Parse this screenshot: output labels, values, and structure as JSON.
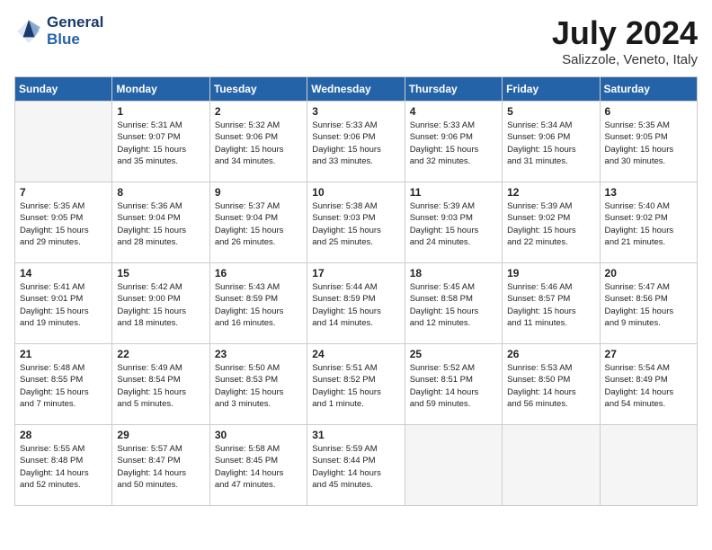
{
  "header": {
    "logo_line1": "General",
    "logo_line2": "Blue",
    "month": "July 2024",
    "location": "Salizzole, Veneto, Italy"
  },
  "weekdays": [
    "Sunday",
    "Monday",
    "Tuesday",
    "Wednesday",
    "Thursday",
    "Friday",
    "Saturday"
  ],
  "weeks": [
    [
      {
        "day": "",
        "info": ""
      },
      {
        "day": "1",
        "info": "Sunrise: 5:31 AM\nSunset: 9:07 PM\nDaylight: 15 hours\nand 35 minutes."
      },
      {
        "day": "2",
        "info": "Sunrise: 5:32 AM\nSunset: 9:06 PM\nDaylight: 15 hours\nand 34 minutes."
      },
      {
        "day": "3",
        "info": "Sunrise: 5:33 AM\nSunset: 9:06 PM\nDaylight: 15 hours\nand 33 minutes."
      },
      {
        "day": "4",
        "info": "Sunrise: 5:33 AM\nSunset: 9:06 PM\nDaylight: 15 hours\nand 32 minutes."
      },
      {
        "day": "5",
        "info": "Sunrise: 5:34 AM\nSunset: 9:06 PM\nDaylight: 15 hours\nand 31 minutes."
      },
      {
        "day": "6",
        "info": "Sunrise: 5:35 AM\nSunset: 9:05 PM\nDaylight: 15 hours\nand 30 minutes."
      }
    ],
    [
      {
        "day": "7",
        "info": "Sunrise: 5:35 AM\nSunset: 9:05 PM\nDaylight: 15 hours\nand 29 minutes."
      },
      {
        "day": "8",
        "info": "Sunrise: 5:36 AM\nSunset: 9:04 PM\nDaylight: 15 hours\nand 28 minutes."
      },
      {
        "day": "9",
        "info": "Sunrise: 5:37 AM\nSunset: 9:04 PM\nDaylight: 15 hours\nand 26 minutes."
      },
      {
        "day": "10",
        "info": "Sunrise: 5:38 AM\nSunset: 9:03 PM\nDaylight: 15 hours\nand 25 minutes."
      },
      {
        "day": "11",
        "info": "Sunrise: 5:39 AM\nSunset: 9:03 PM\nDaylight: 15 hours\nand 24 minutes."
      },
      {
        "day": "12",
        "info": "Sunrise: 5:39 AM\nSunset: 9:02 PM\nDaylight: 15 hours\nand 22 minutes."
      },
      {
        "day": "13",
        "info": "Sunrise: 5:40 AM\nSunset: 9:02 PM\nDaylight: 15 hours\nand 21 minutes."
      }
    ],
    [
      {
        "day": "14",
        "info": "Sunrise: 5:41 AM\nSunset: 9:01 PM\nDaylight: 15 hours\nand 19 minutes."
      },
      {
        "day": "15",
        "info": "Sunrise: 5:42 AM\nSunset: 9:00 PM\nDaylight: 15 hours\nand 18 minutes."
      },
      {
        "day": "16",
        "info": "Sunrise: 5:43 AM\nSunset: 8:59 PM\nDaylight: 15 hours\nand 16 minutes."
      },
      {
        "day": "17",
        "info": "Sunrise: 5:44 AM\nSunset: 8:59 PM\nDaylight: 15 hours\nand 14 minutes."
      },
      {
        "day": "18",
        "info": "Sunrise: 5:45 AM\nSunset: 8:58 PM\nDaylight: 15 hours\nand 12 minutes."
      },
      {
        "day": "19",
        "info": "Sunrise: 5:46 AM\nSunset: 8:57 PM\nDaylight: 15 hours\nand 11 minutes."
      },
      {
        "day": "20",
        "info": "Sunrise: 5:47 AM\nSunset: 8:56 PM\nDaylight: 15 hours\nand 9 minutes."
      }
    ],
    [
      {
        "day": "21",
        "info": "Sunrise: 5:48 AM\nSunset: 8:55 PM\nDaylight: 15 hours\nand 7 minutes."
      },
      {
        "day": "22",
        "info": "Sunrise: 5:49 AM\nSunset: 8:54 PM\nDaylight: 15 hours\nand 5 minutes."
      },
      {
        "day": "23",
        "info": "Sunrise: 5:50 AM\nSunset: 8:53 PM\nDaylight: 15 hours\nand 3 minutes."
      },
      {
        "day": "24",
        "info": "Sunrise: 5:51 AM\nSunset: 8:52 PM\nDaylight: 15 hours\nand 1 minute."
      },
      {
        "day": "25",
        "info": "Sunrise: 5:52 AM\nSunset: 8:51 PM\nDaylight: 14 hours\nand 59 minutes."
      },
      {
        "day": "26",
        "info": "Sunrise: 5:53 AM\nSunset: 8:50 PM\nDaylight: 14 hours\nand 56 minutes."
      },
      {
        "day": "27",
        "info": "Sunrise: 5:54 AM\nSunset: 8:49 PM\nDaylight: 14 hours\nand 54 minutes."
      }
    ],
    [
      {
        "day": "28",
        "info": "Sunrise: 5:55 AM\nSunset: 8:48 PM\nDaylight: 14 hours\nand 52 minutes."
      },
      {
        "day": "29",
        "info": "Sunrise: 5:57 AM\nSunset: 8:47 PM\nDaylight: 14 hours\nand 50 minutes."
      },
      {
        "day": "30",
        "info": "Sunrise: 5:58 AM\nSunset: 8:45 PM\nDaylight: 14 hours\nand 47 minutes."
      },
      {
        "day": "31",
        "info": "Sunrise: 5:59 AM\nSunset: 8:44 PM\nDaylight: 14 hours\nand 45 minutes."
      },
      {
        "day": "",
        "info": ""
      },
      {
        "day": "",
        "info": ""
      },
      {
        "day": "",
        "info": ""
      }
    ]
  ]
}
